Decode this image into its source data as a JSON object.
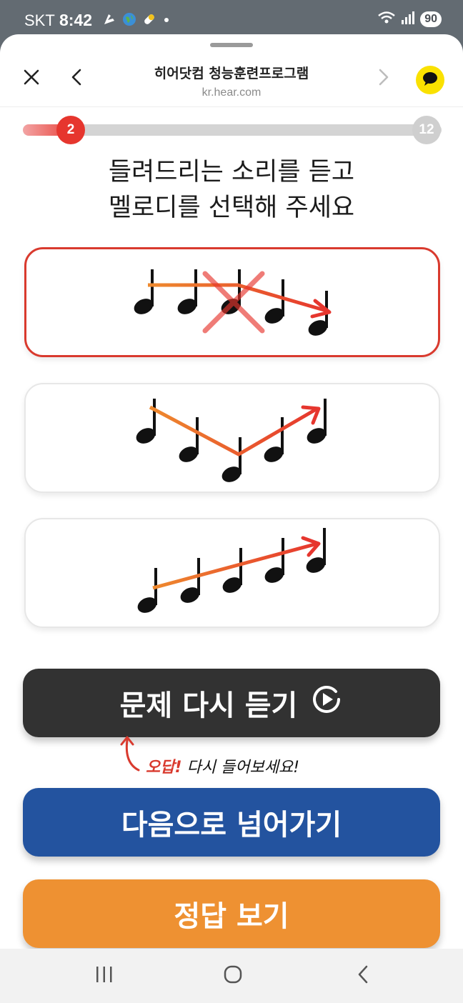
{
  "status_bar": {
    "carrier": "SKT",
    "time": "8:42",
    "battery": "90",
    "icons": [
      "notification-icon",
      "globe-icon",
      "pill-icon",
      "dot-icon",
      "wifi-icon",
      "signal-icon"
    ]
  },
  "header": {
    "title": "히어닷컴 청능훈련프로그램",
    "url": "kr.hear.com",
    "icons": [
      "close-icon",
      "back-icon",
      "forward-icon",
      "kakaotalk-icon"
    ]
  },
  "progress": {
    "current": "2",
    "total": "12",
    "fraction": 0.1
  },
  "question": {
    "line1": "들려드리는 소리를 듣고",
    "line2": "멜로디를 선택해 주세요"
  },
  "options": [
    {
      "pattern": "flat-then-down",
      "state": "wrong"
    },
    {
      "pattern": "down-then-up",
      "state": "default"
    },
    {
      "pattern": "ascending",
      "state": "default"
    }
  ],
  "buttons": {
    "replay": "문제 다시 듣기",
    "next": "다음으로 넘어가기",
    "answer": "정답 보기"
  },
  "hint": {
    "wrong": "오답!",
    "rest": "다시 들어보세요!"
  },
  "colors": {
    "accent_red": "#e6362e",
    "dark_button": "#323232",
    "blue_button": "#23539f",
    "orange_button": "#ee9132",
    "arrow_orange": "#ee7a2e"
  }
}
